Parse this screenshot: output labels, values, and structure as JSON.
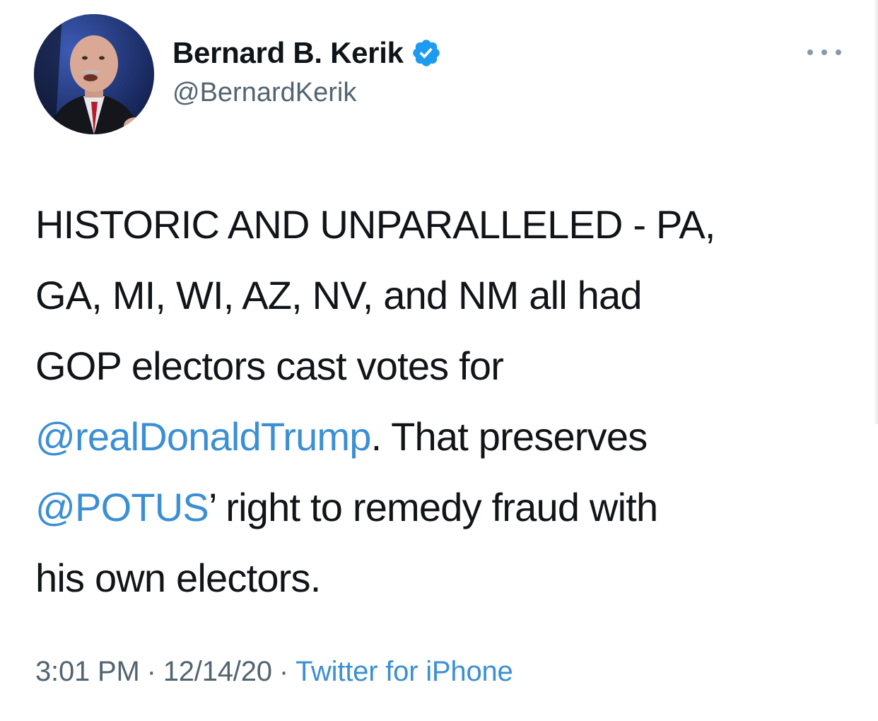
{
  "author": {
    "display_name": "Bernard B. Kerik",
    "handle": "@BernardKerik",
    "verified": true,
    "avatar_icon": "profile-photo"
  },
  "more_icon": "more-horizontal-icon",
  "tweet": {
    "lines": [
      [
        {
          "text": "HISTORIC AND UNPARALLELED - PA,",
          "type": "text"
        }
      ],
      [
        {
          "text": "GA, MI, WI, AZ, NV, and NM all had",
          "type": "text"
        }
      ],
      [
        {
          "text": "GOP electors cast votes for",
          "type": "text"
        }
      ],
      [
        {
          "text": "@realDonaldTrump",
          "type": "mention"
        },
        {
          "text": ". That preserves",
          "type": "text"
        }
      ],
      [
        {
          "text": "@POTUS",
          "type": "mention"
        },
        {
          "text": "’ right to remedy fraud with",
          "type": "text"
        }
      ],
      [
        {
          "text": "his own electors.",
          "type": "text"
        }
      ]
    ]
  },
  "meta": {
    "time": "3:01 PM",
    "separator": "·",
    "date": "12/14/20",
    "source": "Twitter for iPhone"
  },
  "colors": {
    "link": "#3b8fd4",
    "verified_badge": "#1d9bf0",
    "secondary_text": "#536471",
    "primary_text": "#111418"
  }
}
